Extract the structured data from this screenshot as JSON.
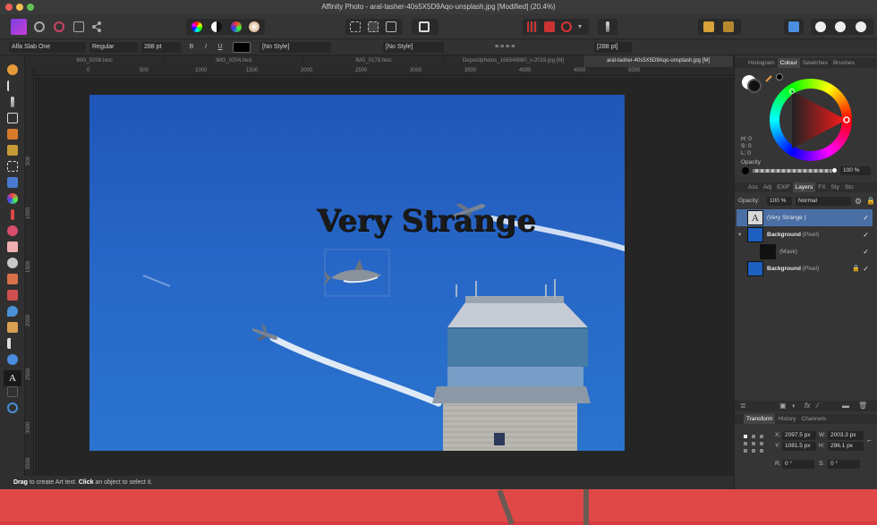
{
  "window": {
    "title": "Affinity Photo - aral-tasher-40s5X5D9Aqo-unsplash.jpg [Modified] (20.4%)"
  },
  "context_bar": {
    "font_family": "Alfa Slab One",
    "font_style": "Regular",
    "font_size": "288 pt",
    "bold": "B",
    "italic": "I",
    "underline": "U",
    "char_style": "[No Style]",
    "para_style": "[No Style]",
    "leading": "[288 pt]"
  },
  "tabs": [
    {
      "label": "IMG_0208.heic",
      "active": false
    },
    {
      "label": "IMG_0204.heic",
      "active": false
    },
    {
      "label": "IMG_0178.heic",
      "active": false
    },
    {
      "label": "Depositphotos_166349880_s-2019.jpg [M]",
      "active": false
    },
    {
      "label": "aral-tasher-40s5X5D9Aqo-unsplash.jpg [M]",
      "active": true
    }
  ],
  "ruler": {
    "unit": "px",
    "h_ticks": [
      "0",
      "500",
      "1000",
      "1500",
      "2000",
      "2500",
      "3000",
      "3500",
      "4000",
      "4500",
      "5000"
    ],
    "v_ticks": [
      "500",
      "1000",
      "1500",
      "2000",
      "2500",
      "3000",
      "3500"
    ]
  },
  "canvas": {
    "art_text": "Very Strange"
  },
  "status": {
    "drag": "Drag",
    "drag_text": " to create Art text. ",
    "click": "Click",
    "click_text": " an object to select it."
  },
  "colour_panel": {
    "tabs": [
      "Histogram",
      "Colour",
      "Swatches",
      "Brushes"
    ],
    "active_tab": "Colour",
    "h": "H: 0",
    "s": "S: 0",
    "l": "L: 0",
    "opacity_label": "Opacity",
    "opacity_value": "100 %"
  },
  "layers_panel": {
    "tabs": [
      "Ass",
      "Adj",
      "EXIF",
      "Layers",
      "FX",
      "Sty",
      "Sto"
    ],
    "active_tab": "Layers",
    "opacity_label": "Opacity:",
    "opacity_value": "100 %",
    "blend_mode": "Normal",
    "layers": [
      {
        "name": "(Very Strange )",
        "kind": "",
        "type": "text",
        "selected": true
      },
      {
        "name": "Background",
        "kind": " (Pixel)",
        "type": "pixel",
        "selected": false
      },
      {
        "name": "(Mask)",
        "kind": "",
        "type": "mask",
        "selected": false
      },
      {
        "name": "Background",
        "kind": " (Pixel)",
        "type": "pixel",
        "selected": false
      }
    ]
  },
  "transform_panel": {
    "tabs": [
      "Transform",
      "History",
      "Channels"
    ],
    "active_tab": "Transform",
    "x_label": "X:",
    "x_value": "2097.5 px",
    "y_label": "Y:",
    "y_value": "1081.5 px",
    "w_label": "W:",
    "w_value": "2003.3 px",
    "h_label": "H:",
    "h_value": "296.1 px",
    "r_label": "R:",
    "r_value": "0 °",
    "s_label": "S:",
    "s_value": "0 °"
  },
  "colors": {
    "app_bg": "#2f2f2f",
    "sky": "#2766c6",
    "accent_blue": "#4a6fa5",
    "desk": "#d83a3f"
  }
}
